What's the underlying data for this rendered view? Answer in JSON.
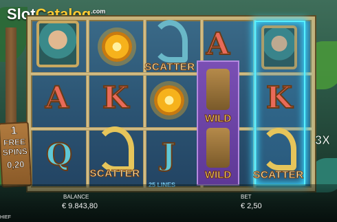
{
  "watermark": {
    "slot": "Slot",
    "catalog": "Catalog",
    "domain": ".com"
  },
  "reels": {
    "col1": [
      "portrait",
      "A",
      "Q"
    ],
    "col2": [
      "sun",
      "K",
      "S"
    ],
    "col3": [
      "S",
      "sun",
      "J"
    ],
    "col4": [
      "A",
      "W",
      "W"
    ],
    "col5": [
      "portrait",
      "K",
      "S"
    ]
  },
  "symbols": {
    "scatter": "SCATTER",
    "wild": "WILD"
  },
  "lines": "25 LINES",
  "left_sign": {
    "line1": "1",
    "line2": "FREE",
    "line3": "SPINS",
    "line4": "0,20"
  },
  "multiplier": "3X",
  "footer": {
    "balance_label": "BALANCE",
    "balance_value": "€ 9.843,80",
    "bet_label": "BET",
    "bet_value": "€ 2,50",
    "bottom_text": "HIEF"
  },
  "colors": {
    "frame": "#c8b27a",
    "glow": "#36d6ff",
    "wild_bg": "#7a4fb4",
    "scatter_text": "#fff6c0"
  }
}
